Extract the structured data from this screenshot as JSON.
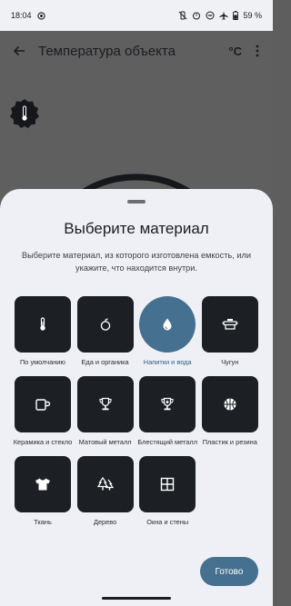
{
  "status_bar": {
    "time": "18:04",
    "battery": "59 %"
  },
  "header": {
    "title": "Температура объекта",
    "unit_button": "°C"
  },
  "sheet": {
    "title": "Выберите материал",
    "description": "Выберите материал, из которого изготовлена емкость, или укажите, что находится внутри.",
    "materials": [
      {
        "label": "По умолчанию",
        "icon": "thermometer-icon",
        "selected": false
      },
      {
        "label": "Еда и органика",
        "icon": "apple-icon",
        "selected": false
      },
      {
        "label": "Напитки и вода",
        "icon": "water-drop-icon",
        "selected": true
      },
      {
        "label": "Чугун",
        "icon": "pan-icon",
        "selected": false
      },
      {
        "label": "Керамика и стекло",
        "icon": "mug-icon",
        "selected": false
      },
      {
        "label": "Матовый металл",
        "icon": "trophy-icon",
        "selected": false
      },
      {
        "label": "Блестящий металл",
        "icon": "shiny-trophy-icon",
        "selected": false
      },
      {
        "label": "Пластик и резина",
        "icon": "basketball-icon",
        "selected": false
      },
      {
        "label": "Ткань",
        "icon": "tshirt-icon",
        "selected": false
      },
      {
        "label": "Дерево",
        "icon": "forest-icon",
        "selected": false
      },
      {
        "label": "Окна и стены",
        "icon": "window-icon",
        "selected": false
      }
    ],
    "done_button": "Готово"
  },
  "colors": {
    "accent": "#46708f",
    "tile": "#1c1f24",
    "sheet": "#eef0f5"
  }
}
